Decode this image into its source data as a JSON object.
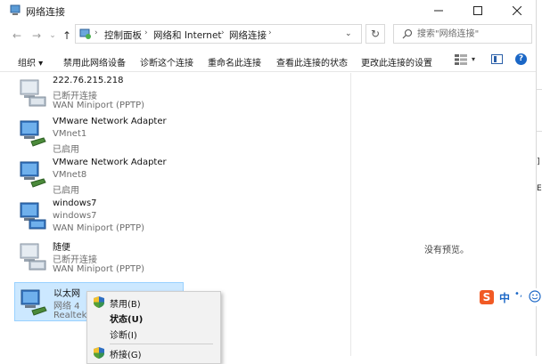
{
  "window": {
    "title": "网络连接",
    "controls": {
      "minimize": "—",
      "maximize": "☐",
      "close": "✕"
    }
  },
  "nav": {
    "back": "←",
    "forward": "→",
    "recent": "⌄",
    "up": "↑",
    "breadcrumb": [
      "控制面板",
      "网络和 Internet",
      "网络连接"
    ],
    "separator": "›",
    "dropdown": "⌄",
    "refresh": "↻",
    "search_placeholder": "搜索\"网络连接\""
  },
  "toolbar": {
    "organize": "组织 ▾",
    "disable": "禁用此网络设备",
    "diagnose": "诊断这个连接",
    "rename": "重命名此连接",
    "status": "查看此连接的状态",
    "change_settings": "更改此连接的设置",
    "view_chevron": "▾",
    "help": "?"
  },
  "connections": [
    {
      "name": "222.76.215.218",
      "status": "已断开连接",
      "device": "WAN Miniport (PPTP)",
      "type": "vpn"
    },
    {
      "name": "VMware Network Adapter",
      "status": "VMnet1",
      "device": "已启用",
      "type": "ethernet"
    },
    {
      "name": "VMware Network Adapter",
      "status": "VMnet8",
      "device": "已启用",
      "type": "ethernet"
    },
    {
      "name": "windows7",
      "status": "windows7",
      "device": "WAN Miniport (PPTP)",
      "type": "vpn"
    },
    {
      "name": "随便",
      "status": "已断开连接",
      "device": "WAN Miniport (PPTP)",
      "type": "vpn"
    },
    {
      "name": "以太网",
      "status": "网络 4",
      "device": "Realtek",
      "type": "ethernet",
      "selected": true
    }
  ],
  "preview": {
    "text": "没有预览。"
  },
  "context_menu": {
    "items": [
      {
        "label": "禁用(B)",
        "shield": true,
        "bold": false
      },
      {
        "label": "状态(U)",
        "shield": false,
        "bold": true
      },
      {
        "label": "诊断(I)",
        "shield": false,
        "bold": false
      },
      {
        "label": "桥接(G)",
        "shield": true,
        "bold": false
      }
    ]
  },
  "ime": {
    "logo": "S",
    "mode": "中",
    "punct": "•,"
  },
  "edge": {
    "text1": "]",
    "text2": "E"
  },
  "colors": {
    "selection_bg": "#cce8ff",
    "selection_border": "#99d1ff",
    "accent": "#1b67c6",
    "sogou": "#f15a24"
  }
}
